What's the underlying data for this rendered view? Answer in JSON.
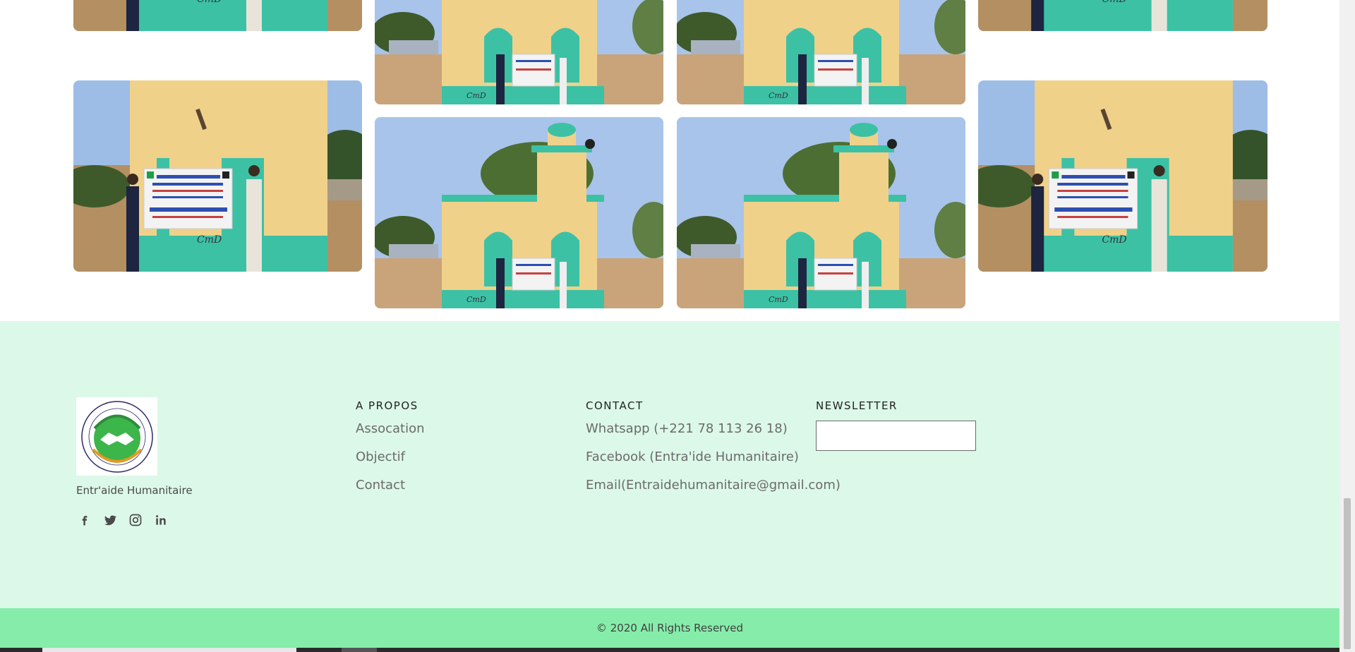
{
  "gallery": {
    "images": [
      {
        "name": "mosque-photo-tall-window-top"
      },
      {
        "name": "mosque-photo-minaret-top"
      },
      {
        "name": "mosque-photo-minaret-top-2"
      },
      {
        "name": "mosque-photo-tall-window-top-2"
      },
      {
        "name": "mosque-photo-banner"
      },
      {
        "name": "mosque-photo-minaret"
      },
      {
        "name": "mosque-photo-minaret-2"
      },
      {
        "name": "mosque-photo-banner-2"
      }
    ],
    "banner_text": "MOSQUEE AICHA BINT ABI BAKR"
  },
  "footer": {
    "brand_name": "Entr'aide Humanitaire",
    "logo_text": "COOPERATION FOR THE SERVICE OF HUMANITY",
    "social": [
      {
        "icon": "facebook-icon"
      },
      {
        "icon": "twitter-icon"
      },
      {
        "icon": "instagram-icon"
      },
      {
        "icon": "linkedin-icon"
      }
    ],
    "about": {
      "heading": "A PROPOS",
      "links": [
        "Assocation",
        "Objectif",
        "Contact"
      ]
    },
    "contact": {
      "heading": "CONTACT",
      "items": [
        "Whatsapp (+221 78 113 26 18)",
        "Facebook (Entra'ide Humanitaire)",
        "Email(Entraidehumanitaire@gmail.com)"
      ]
    },
    "newsletter": {
      "heading": "NEWSLETTER",
      "input_value": ""
    },
    "copyright": "© 2020 All Rights Reserved"
  },
  "colors": {
    "footer_bg": "#dcf8e8",
    "bottom_bar_bg": "#86eca9",
    "wall": "#f0d18a",
    "trim": "#3cc1a5"
  }
}
